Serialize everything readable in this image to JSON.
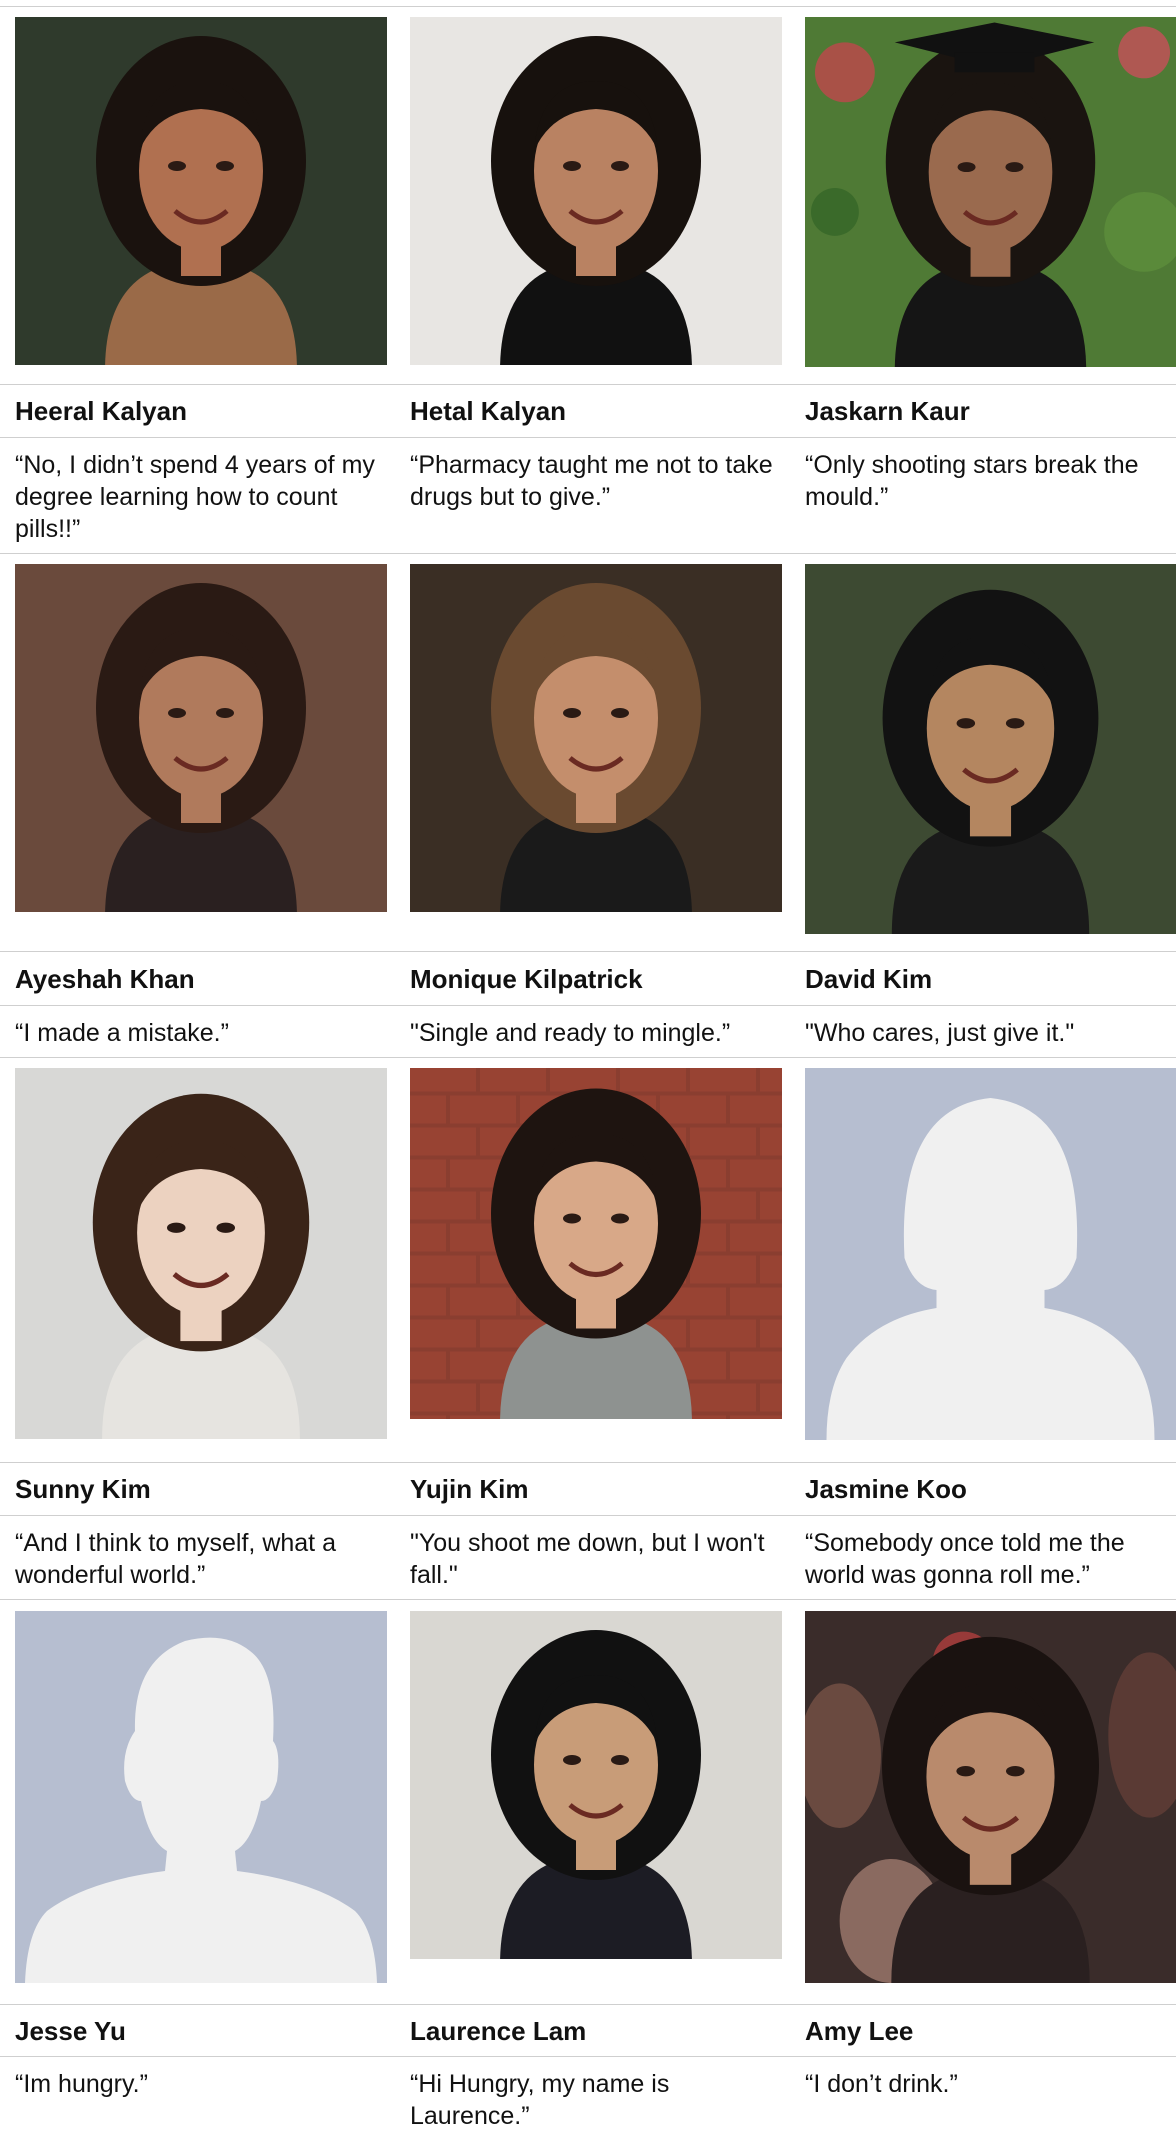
{
  "people": [
    {
      "name": "Heeral Kalyan",
      "quote": "“No, I didn’t spend 4 years of my degree learning how to count pills!!”",
      "photo": "photo-portrait",
      "bg": "#2f3a2c",
      "skin": "#b07050",
      "hair": "#1a120e",
      "shirt": "#9a6a48"
    },
    {
      "name": "Hetal Kalyan",
      "quote": "“Pharmacy taught me not to take drugs but to give.”",
      "photo": "photo-portrait",
      "bg": "#e8e6e3",
      "skin": "#b98262",
      "hair": "#17110d",
      "shirt": "#111111"
    },
    {
      "name": "Jaskarn Kaur",
      "quote": "“Only shooting stars break the mould.”",
      "photo": "photo-portrait-graduate",
      "bg": "#4f7a35",
      "skin": "#9a6a4e",
      "hair": "#1a1410",
      "shirt": "#151515"
    },
    {
      "name": "Ayeshah Khan",
      "quote": "“I made a mistake.”",
      "photo": "photo-portrait",
      "bg": "#6a4a3c",
      "skin": "#b07a5c",
      "hair": "#2a1a14",
      "shirt": "#2a2020"
    },
    {
      "name": "Monique Kilpatrick",
      "quote": "\"Single and ready to mingle.”",
      "photo": "photo-portrait",
      "bg": "#3a2e24",
      "skin": "#c48e6c",
      "hair": "#6a4a30",
      "shirt": "#1a1a1a"
    },
    {
      "name": "David Kim",
      "quote": "\"Who cares, just give it.\"",
      "photo": "photo-portrait",
      "bg": "#3d4a32",
      "skin": "#b48660",
      "hair": "#121212",
      "shirt": "#1a1a1a"
    },
    {
      "name": "Sunny Kim",
      "quote": "“And I think to myself, what a wonderful world.”",
      "photo": "photo-portrait",
      "bg": "#d8d8d6",
      "skin": "#ecd2c0",
      "hair": "#3a2418",
      "shirt": "#e6e4e0"
    },
    {
      "name": "Yujin Kim",
      "quote": "\"You shoot me down, but I won't fall.\"",
      "photo": "photo-portrait-brick",
      "bg": "#8a3e30",
      "skin": "#d8a888",
      "hair": "#1e1410",
      "shirt": "#8e9290"
    },
    {
      "name": "Jasmine Koo",
      "quote": "“Somebody once told me the world was gonna roll me.”",
      "photo": "default-avatar-female",
      "bg": "#b6bed0",
      "skin": "#f0f0f0",
      "hair": "#f0f0f0",
      "shirt": "#f0f0f0"
    },
    {
      "name": "Jesse Yu",
      "quote": "“Im hungry.”",
      "photo": "default-avatar-male",
      "bg": "#b6bed0",
      "skin": "#f0f0f0",
      "hair": "#f0f0f0",
      "shirt": "#f0f0f0"
    },
    {
      "name": "Laurence Lam",
      "quote": "“Hi Hungry, my name is Laurence.”",
      "photo": "photo-portrait",
      "bg": "#d9d7d2",
      "skin": "#c89c78",
      "hair": "#111111",
      "shirt": "#1c1c24"
    },
    {
      "name": "Amy Lee",
      "quote": "“I don’t drink.”",
      "photo": "photo-portrait-crowd",
      "bg": "#3a2c2a",
      "skin": "#b98a6c",
      "hair": "#1a1210",
      "shirt": "#2a2020"
    }
  ]
}
